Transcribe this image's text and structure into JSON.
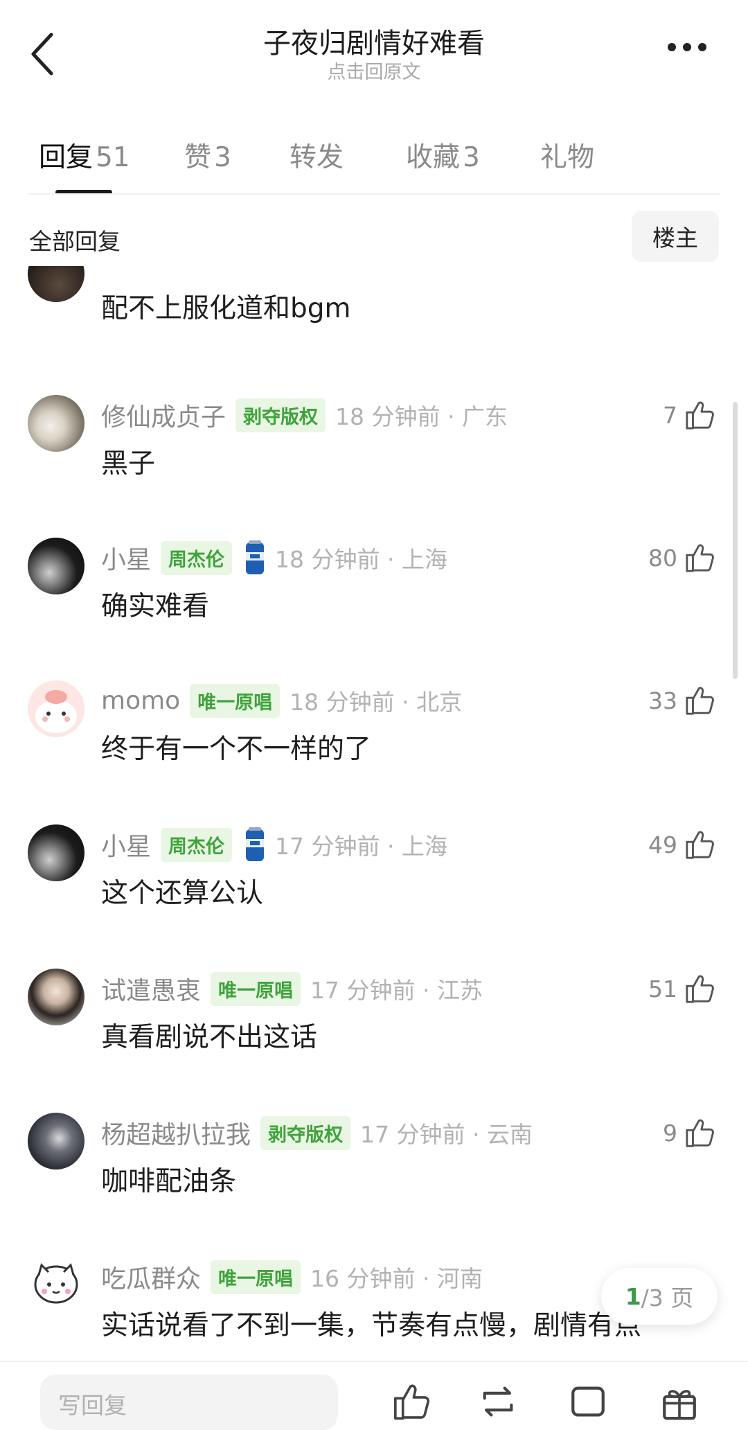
{
  "header": {
    "title": "子夜归剧情好难看",
    "subtitle": "点击回原文"
  },
  "tabs": [
    {
      "label": "回复",
      "count": "51",
      "active": true
    },
    {
      "label": "赞",
      "count": "3",
      "active": false
    },
    {
      "label": "转发",
      "count": "",
      "active": false
    },
    {
      "label": "收藏",
      "count": "3",
      "active": false
    },
    {
      "label": "礼物",
      "count": "",
      "active": false
    }
  ],
  "section": {
    "all_label": "全部回复",
    "owner_label": "楼主"
  },
  "comments": [
    {
      "text": "配不上服化道和bgm"
    },
    {
      "user": "修仙成贞子",
      "badge": "剥夺版权",
      "time": "18 分钟前 · 广东",
      "likes": "7",
      "text": "黑子"
    },
    {
      "user": "小星",
      "badge": "周杰伦",
      "time": "18 分钟前 · 上海",
      "likes": "80",
      "text": "确实难看"
    },
    {
      "user": "momo",
      "badge": "唯一原唱",
      "time": "18 分钟前 · 北京",
      "likes": "33",
      "text": "终于有一个不一样的了"
    },
    {
      "user": "小星",
      "badge": "周杰伦",
      "time": "17 分钟前 · 上海",
      "likes": "49",
      "text": "这个还算公认"
    },
    {
      "user": "试遣愚衷",
      "badge": "唯一原唱",
      "time": "17 分钟前 · 江苏",
      "likes": "51",
      "text": "真看剧说不出这话"
    },
    {
      "user": "杨超越扒拉我",
      "badge": "剥夺版权",
      "time": "17 分钟前 · 云南",
      "likes": "9",
      "text": "咖啡配油条"
    },
    {
      "user": "吃瓜群众",
      "badge": "唯一原唱",
      "time": "16 分钟前 · 河南",
      "likes": "",
      "text": "实话说看了不到一集，节奏有点慢，剧情有点"
    }
  ],
  "pager": {
    "current": "1",
    "total": "/3 页"
  },
  "bottom": {
    "reply_placeholder": "写回复"
  },
  "colors": {
    "accent_green": "#3fa33b",
    "badge_bg": "#e9f6e4"
  }
}
